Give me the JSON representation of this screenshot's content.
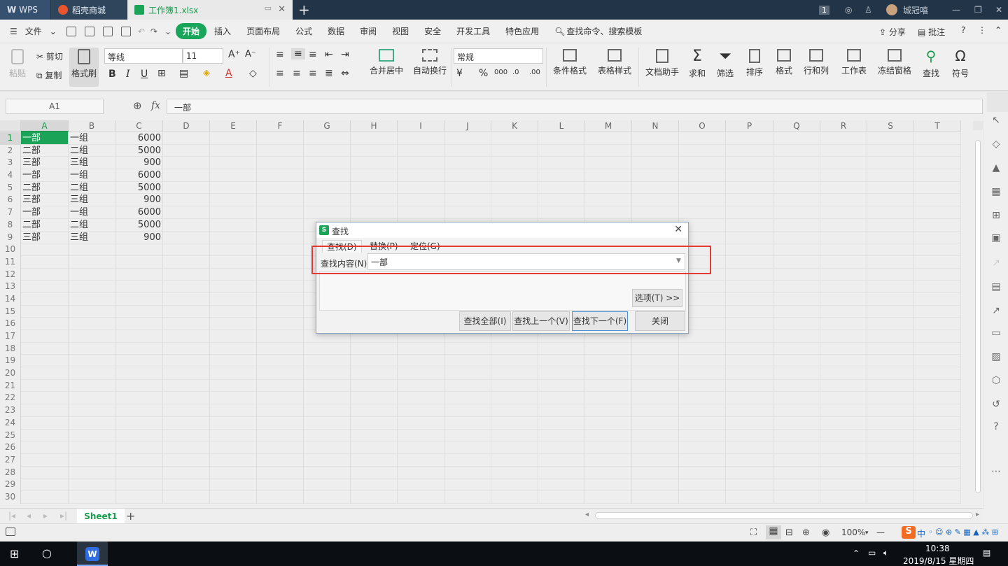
{
  "titlebar": {
    "wps_tab": "WPS",
    "shop_tab": "稻壳商城",
    "file_tab": "工作簿1.xlsx",
    "new_tab": "+",
    "user": "城冠嘻",
    "badge": "1"
  },
  "menubar": {
    "file": "文件",
    "items": [
      "开始",
      "插入",
      "页面布局",
      "公式",
      "数据",
      "审阅",
      "视图",
      "安全",
      "开发工具",
      "特色应用"
    ],
    "search": "查找命令、搜索模板",
    "share": "分享",
    "comment": "批注"
  },
  "ribbon": {
    "paste": "粘贴",
    "cut": "剪切",
    "copy": "复制",
    "format_painter": "格式刷",
    "font_name": "等线",
    "font_size": "11",
    "merge_center": "合并居中",
    "wrap_text": "自动换行",
    "number_format": "常规",
    "cond_format": "条件格式",
    "table_style": "表格样式",
    "doc_helper": "文档助手",
    "sum": "求和",
    "filter": "筛选",
    "sort": "排序",
    "format": "格式",
    "row_col": "行和列",
    "worksheet": "工作表",
    "freeze": "冻结窗格",
    "find": "查找",
    "symbol": "符号"
  },
  "formulabar": {
    "name_box": "A1",
    "fx": "fx",
    "content": "一部"
  },
  "grid": {
    "columns": [
      "A",
      "B",
      "C",
      "D",
      "E",
      "F",
      "G",
      "H",
      "I",
      "J",
      "K",
      "L",
      "M",
      "N",
      "O",
      "P",
      "Q",
      "R",
      "S",
      "T"
    ],
    "rows": [
      "1",
      "2",
      "3",
      "4",
      "5",
      "6",
      "7",
      "8",
      "9",
      "10",
      "11",
      "12",
      "13",
      "14",
      "15",
      "16",
      "17",
      "18",
      "19",
      "20",
      "21",
      "22",
      "23",
      "24",
      "25",
      "26",
      "27",
      "28",
      "29",
      "30"
    ],
    "data": [
      [
        "一部",
        "一组",
        "6000"
      ],
      [
        "二部",
        "二组",
        "5000"
      ],
      [
        "三部",
        "三组",
        "900"
      ],
      [
        "一部",
        "一组",
        "6000"
      ],
      [
        "二部",
        "二组",
        "5000"
      ],
      [
        "三部",
        "三组",
        "900"
      ],
      [
        "一部",
        "一组",
        "6000"
      ],
      [
        "二部",
        "二组",
        "5000"
      ],
      [
        "三部",
        "三组",
        "900"
      ]
    ]
  },
  "sheetbar": {
    "sheet": "Sheet1",
    "add": "+"
  },
  "statusbar": {
    "zoom": "100%"
  },
  "taskbar": {
    "time": "10:38",
    "date": "2019/8/15 星期四",
    "ime": "中"
  },
  "dialog": {
    "title": "查找",
    "tabs": [
      "查找(D)",
      "替换(P)",
      "定位(G)"
    ],
    "label": "查找内容(N):",
    "value": "一部",
    "options_button": "选项(T) >>",
    "find_all": "查找全部(I)",
    "find_prev": "查找上一个(V)",
    "find_next": "查找下一个(F)",
    "close": "关闭"
  },
  "colors": {
    "accent": "#1ba457",
    "highlight_box": "#e53935"
  }
}
